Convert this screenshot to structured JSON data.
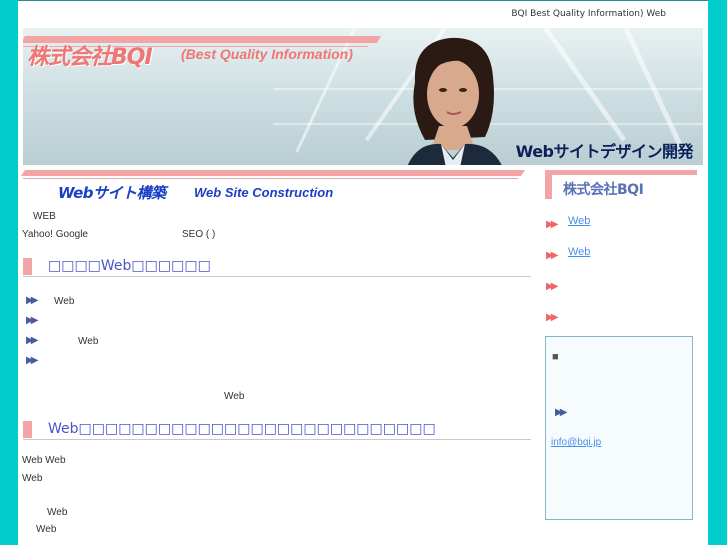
{
  "header": {
    "tagline": "BQI  Best Quality Information) Web",
    "logo_jp": "株式会社BQI",
    "logo_en": "(Best Quality Information)",
    "caption": "Webサイトデザイン開発"
  },
  "main": {
    "section_title_jp": "Webサイト構築",
    "section_title_en": "Web Site Construction",
    "intro_line1": "WEB",
    "intro_line2_a": "Yahoo! Google",
    "intro_line2_b": "SEO (          )",
    "heading1": "□□□□Web□□□□□□",
    "bullets": [
      {
        "text": "Web"
      },
      {
        "text": ""
      },
      {
        "text": "Web"
      },
      {
        "text": ""
      }
    ],
    "center_note": "Web",
    "heading2": "Web□□□□□□□□□□□□□□□□□□□□□□□□□□□",
    "para_lines": [
      "Web               Web",
      "Web",
      "Web",
      "Web"
    ]
  },
  "sidebar": {
    "title": "株式会社BQI",
    "nav": [
      {
        "label": "Web"
      },
      {
        "label": "Web      "
      },
      {
        "label": "  "
      },
      {
        "label": "     "
      }
    ],
    "box_marker": "■",
    "box_email": "info@bqi.jp"
  },
  "icons": {
    "double_arrow": "double-arrow-icon"
  },
  "colors": {
    "background": "#00cccc",
    "accent_pink": "#f3a4a4",
    "heading_blue": "#4a55c8",
    "link_blue": "#4a8ee8"
  }
}
